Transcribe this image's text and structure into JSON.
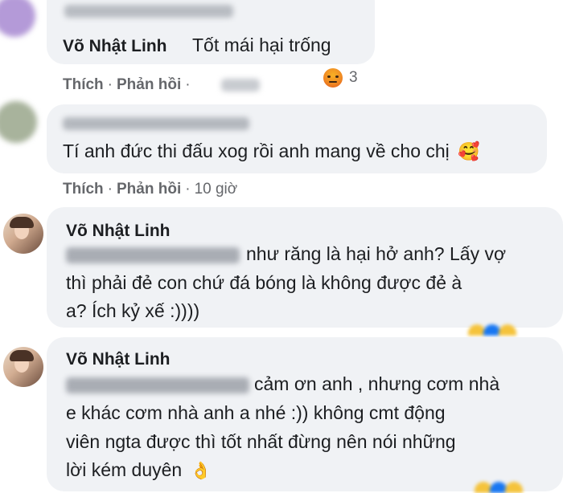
{
  "comments": [
    {
      "author": "Võ Nhật Linh",
      "text": "Tốt mái hại trống",
      "like_label": "Thích",
      "reply_label": "Phản hồi",
      "separator": "·",
      "reaction_count": "3",
      "reaction_icon": "angry-reaction-icon"
    },
    {
      "text": "Tí anh đức thi đấu xog rồi anh mang về cho chị",
      "emoji": "🥰",
      "like_label": "Thích",
      "reply_label": "Phản hồi",
      "separator": "·",
      "time": "10 giờ"
    },
    {
      "author": "Võ Nhật Linh",
      "lines": [
        "như răng là hại hở anh? Lấy vợ",
        "thì phải đẻ con chứ đá bóng là không được đẻ à",
        "a? Ích kỷ xế :))))"
      ]
    },
    {
      "author": "Võ Nhật Linh",
      "lines": [
        "cảm ơn anh , nhưng cơm nhà",
        "e khác cơm nhà anh a nhé :)) không cmt động",
        "viên ngta được thì tốt nhất đừng nên nói những",
        "lời kém duyên"
      ],
      "emoji": "👌"
    }
  ]
}
